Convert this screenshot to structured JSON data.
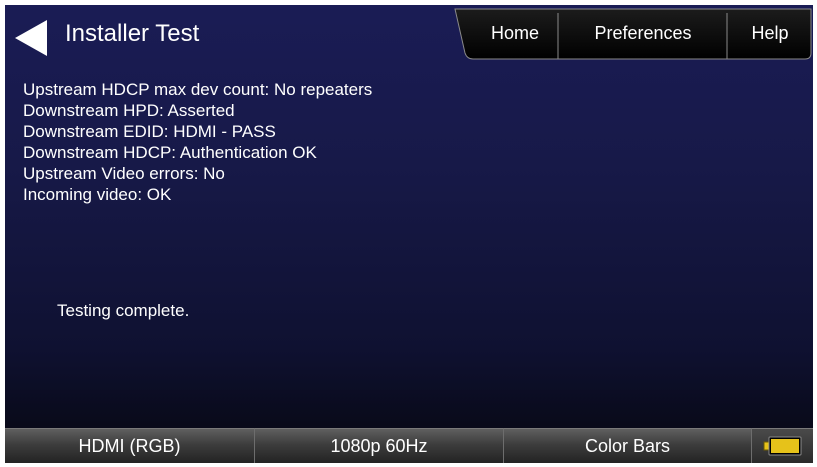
{
  "header": {
    "title": "Installer Test",
    "back_icon": "back-arrow-icon",
    "tabs": [
      {
        "label": "Home"
      },
      {
        "label": "Preferences"
      },
      {
        "label": "Help"
      }
    ]
  },
  "status": {
    "lines": [
      "Upstream HDCP max dev count: No repeaters",
      "Downstream HPD: Asserted",
      "Downstream EDID: HDMI - PASS",
      "Downstream HDCP: Authentication OK",
      "Upstream Video errors: No",
      "Incoming video: OK"
    ],
    "result": "Testing complete."
  },
  "bottom_bar": {
    "interface": "HDMI (RGB)",
    "format": "1080p 60Hz",
    "pattern": "Color Bars",
    "battery_icon": "battery-icon"
  },
  "colors": {
    "background_top": "#1a1c55",
    "background_bottom": "#06070f",
    "battery_fill": "#e6c21a"
  }
}
